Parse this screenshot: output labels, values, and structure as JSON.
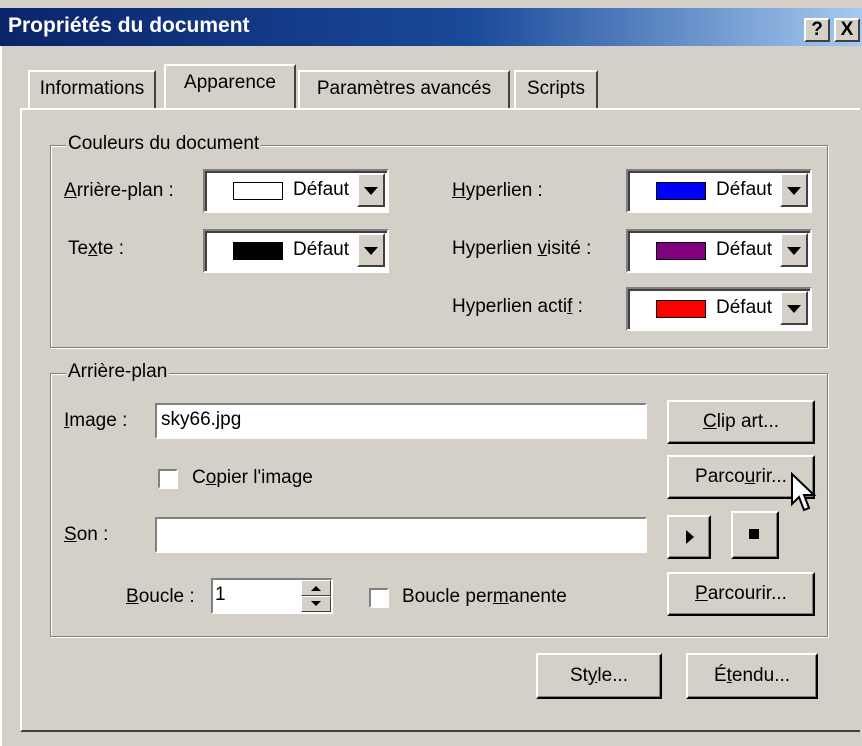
{
  "window": {
    "title": "Propriétés du document",
    "help_button": "?",
    "close_button": "X"
  },
  "tabs": [
    {
      "label": "Informations",
      "active": false
    },
    {
      "label": "Apparence",
      "active": true
    },
    {
      "label": "Paramètres avancés",
      "active": false
    },
    {
      "label": "Scripts",
      "active": false
    }
  ],
  "colors_group": {
    "title": "Couleurs du document",
    "rows": [
      {
        "label_pre": "",
        "label_key": "A",
        "label_post": "rrière-plan :",
        "value": "Défaut",
        "color": "#ffffff"
      },
      {
        "label_pre": "Te",
        "label_key": "x",
        "label_post": "te :",
        "value": "Défaut",
        "color": "#000000"
      },
      {
        "label_pre": "",
        "label_key": "H",
        "label_post": "yperlien :",
        "value": "Défaut",
        "color": "#0000ff"
      },
      {
        "label_pre": "Hyperlien ",
        "label_key": "v",
        "label_post": "isité :",
        "value": "Défaut",
        "color": "#800080"
      },
      {
        "label_pre": "Hyperlien acti",
        "label_key": "f",
        "label_post": " :",
        "value": "Défaut",
        "color": "#ff0000"
      }
    ]
  },
  "background_group": {
    "title": "Arrière-plan",
    "image_label_key": "I",
    "image_label_post": "mage :",
    "image_value": "sky66.jpg",
    "clipart_key": "C",
    "clipart_post": "lip art...",
    "copy_pre": "C",
    "copy_key": "o",
    "copy_post": "pier l'image",
    "copy_checked": false,
    "browse1_pre": "Parco",
    "browse1_key": "u",
    "browse1_post": "rir...",
    "sound_label_key": "S",
    "sound_label_post": "on :",
    "sound_value": "",
    "loop_label_key": "B",
    "loop_label_post": "oucle :",
    "loop_value": "1",
    "loop_perm_pre": "Boucle per",
    "loop_perm_key": "m",
    "loop_perm_post": "anente",
    "loop_perm_checked": false,
    "browse2_key": "P",
    "browse2_post": "arcourir..."
  },
  "footer": {
    "style_pre": "St",
    "style_key": "y",
    "style_post": "le...",
    "extended_pre": "É",
    "extended_key": "t",
    "extended_post": "endu..."
  }
}
